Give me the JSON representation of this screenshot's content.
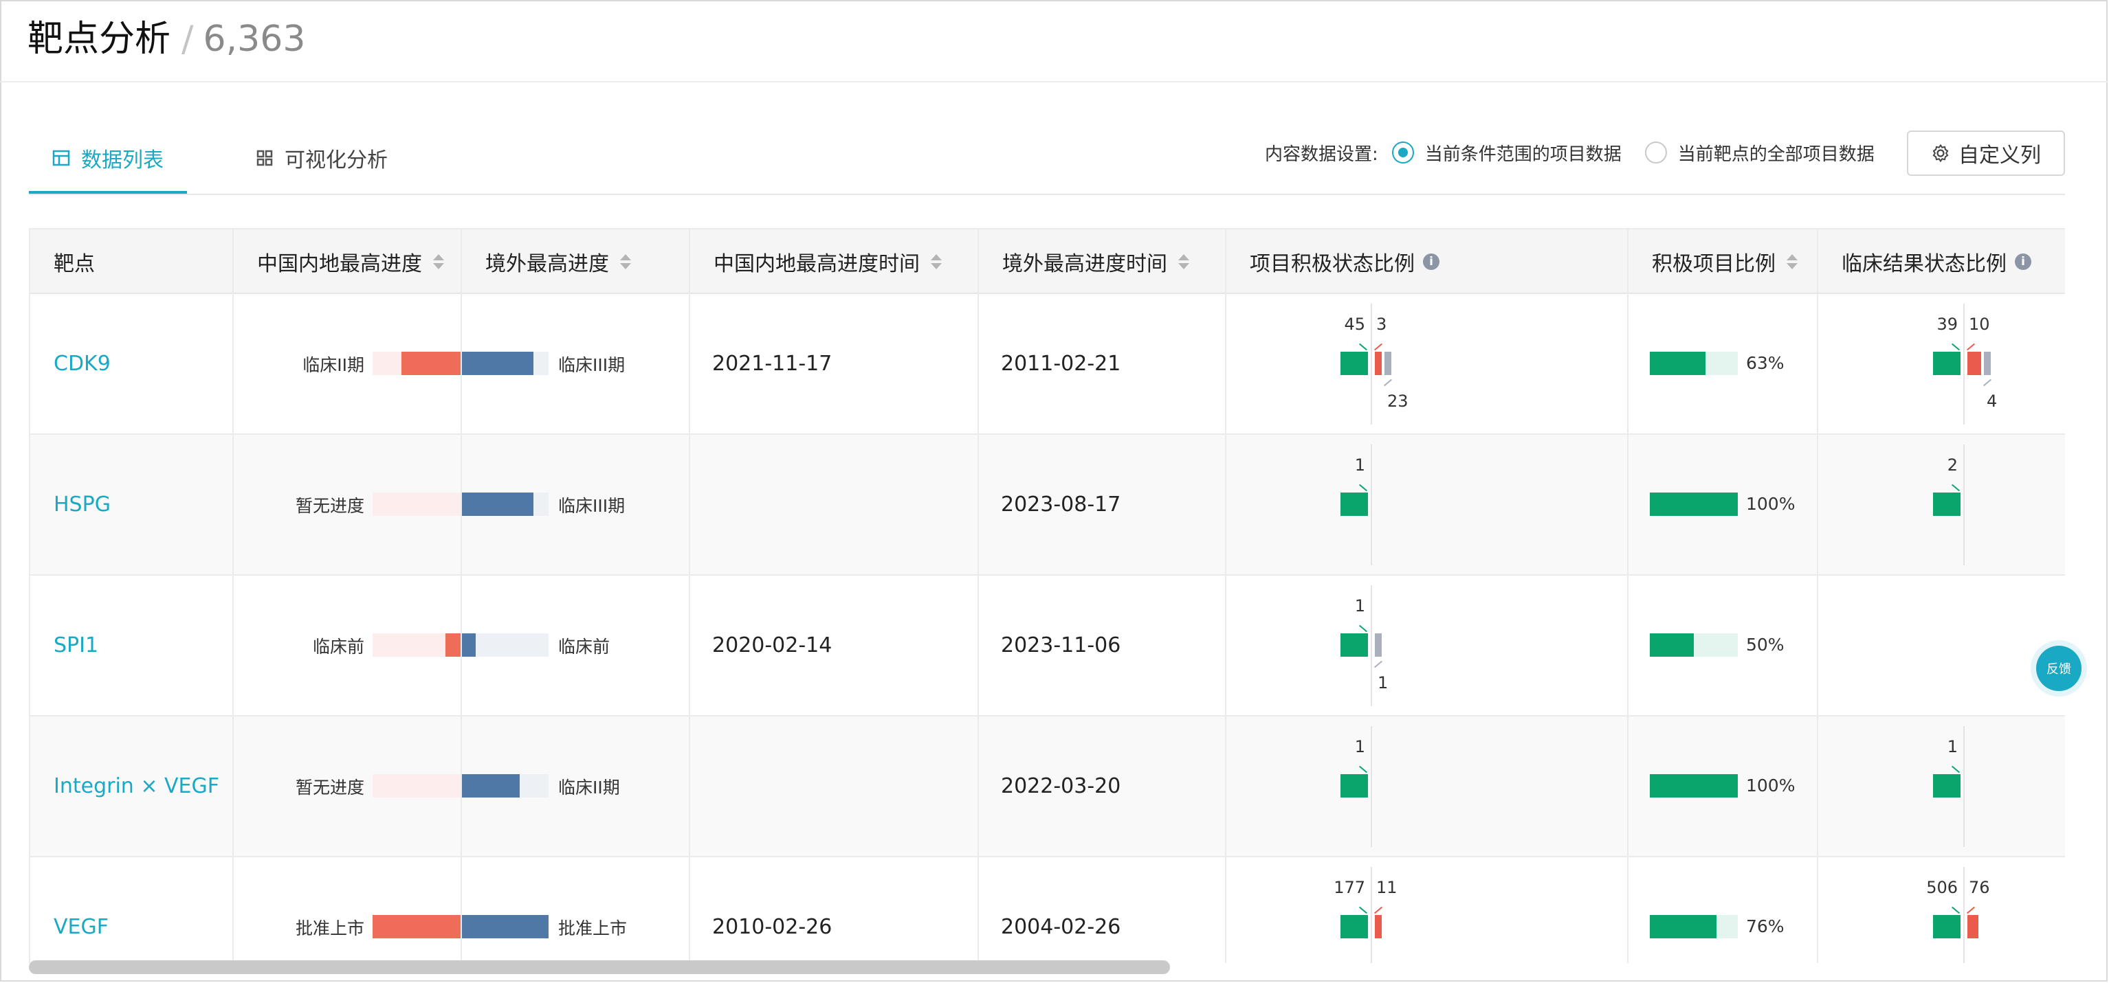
{
  "header": {
    "title": "靶点分析",
    "separator": "/",
    "count": "6,363"
  },
  "tabs": [
    {
      "label": "数据列表",
      "icon": "table-icon",
      "active": true
    },
    {
      "label": "可视化分析",
      "icon": "grid-icon",
      "active": false
    }
  ],
  "settings": {
    "label": "内容数据设置:",
    "options": [
      {
        "label": "当前条件范围的项目数据",
        "selected": true
      },
      {
        "label": "当前靶点的全部项目数据",
        "selected": false
      }
    ],
    "custom_button": "自定义列"
  },
  "table": {
    "columns": [
      "靶点",
      "中国内地最高进度",
      "境外最高进度",
      "中国内地最高进度时间",
      "境外最高进度时间",
      "项目积极状态比例",
      "积极项目比例",
      "临床结果状态比例"
    ],
    "rows": [
      {
        "target": "CDK9",
        "cn_phase": "临床II期",
        "cn_level": 0.67,
        "os_phase": "临床III期",
        "os_level": 0.83,
        "cn_date": "2021-11-17",
        "os_date": "2011-02-21",
        "status_green": "45",
        "status_red": "3",
        "status_gray": "23",
        "positive_pct": "63%",
        "positive_ratio": 0.63,
        "clin_green": "39",
        "clin_red": "10",
        "clin_gray": "4"
      },
      {
        "target": "HSPG",
        "cn_phase": "暂无进度",
        "cn_level": 0,
        "os_phase": "临床III期",
        "os_level": 0.83,
        "cn_date": "",
        "os_date": "2023-08-17",
        "status_green": "1",
        "status_red": "",
        "status_gray": "",
        "positive_pct": "100%",
        "positive_ratio": 1.0,
        "clin_green": "2",
        "clin_red": "",
        "clin_gray": ""
      },
      {
        "target": "SPI1",
        "cn_phase": "临床前",
        "cn_level": 0.17,
        "os_phase": "临床前",
        "os_level": 0.17,
        "cn_date": "2020-02-14",
        "os_date": "2023-11-06",
        "status_green": "1",
        "status_red": "",
        "status_gray": "1",
        "positive_pct": "50%",
        "positive_ratio": 0.5,
        "clin_green": "",
        "clin_red": "",
        "clin_gray": ""
      },
      {
        "target": "Integrin × VEGF",
        "cn_phase": "暂无进度",
        "cn_level": 0,
        "os_phase": "临床II期",
        "os_level": 0.67,
        "cn_date": "",
        "os_date": "2022-03-20",
        "status_green": "1",
        "status_red": "",
        "status_gray": "",
        "positive_pct": "100%",
        "positive_ratio": 1.0,
        "clin_green": "1",
        "clin_red": "",
        "clin_gray": ""
      },
      {
        "target": "VEGF",
        "cn_phase": "批准上市",
        "cn_level": 1.0,
        "os_phase": "批准上市",
        "os_level": 1.0,
        "cn_date": "2010-02-26",
        "os_date": "2004-02-26",
        "status_green": "177",
        "status_red": "11",
        "status_gray": "",
        "positive_pct": "76%",
        "positive_ratio": 0.76,
        "clin_green": "506",
        "clin_red": "76",
        "clin_gray": ""
      }
    ]
  },
  "feedback": "反馈",
  "colors": {
    "accent": "#1aa9c4",
    "cn_bar": "#ef6d58",
    "os_bar": "#4f78a7",
    "positive": "#0aa56c",
    "negative": "#ea5b4c",
    "neutral": "#a9afbd"
  }
}
